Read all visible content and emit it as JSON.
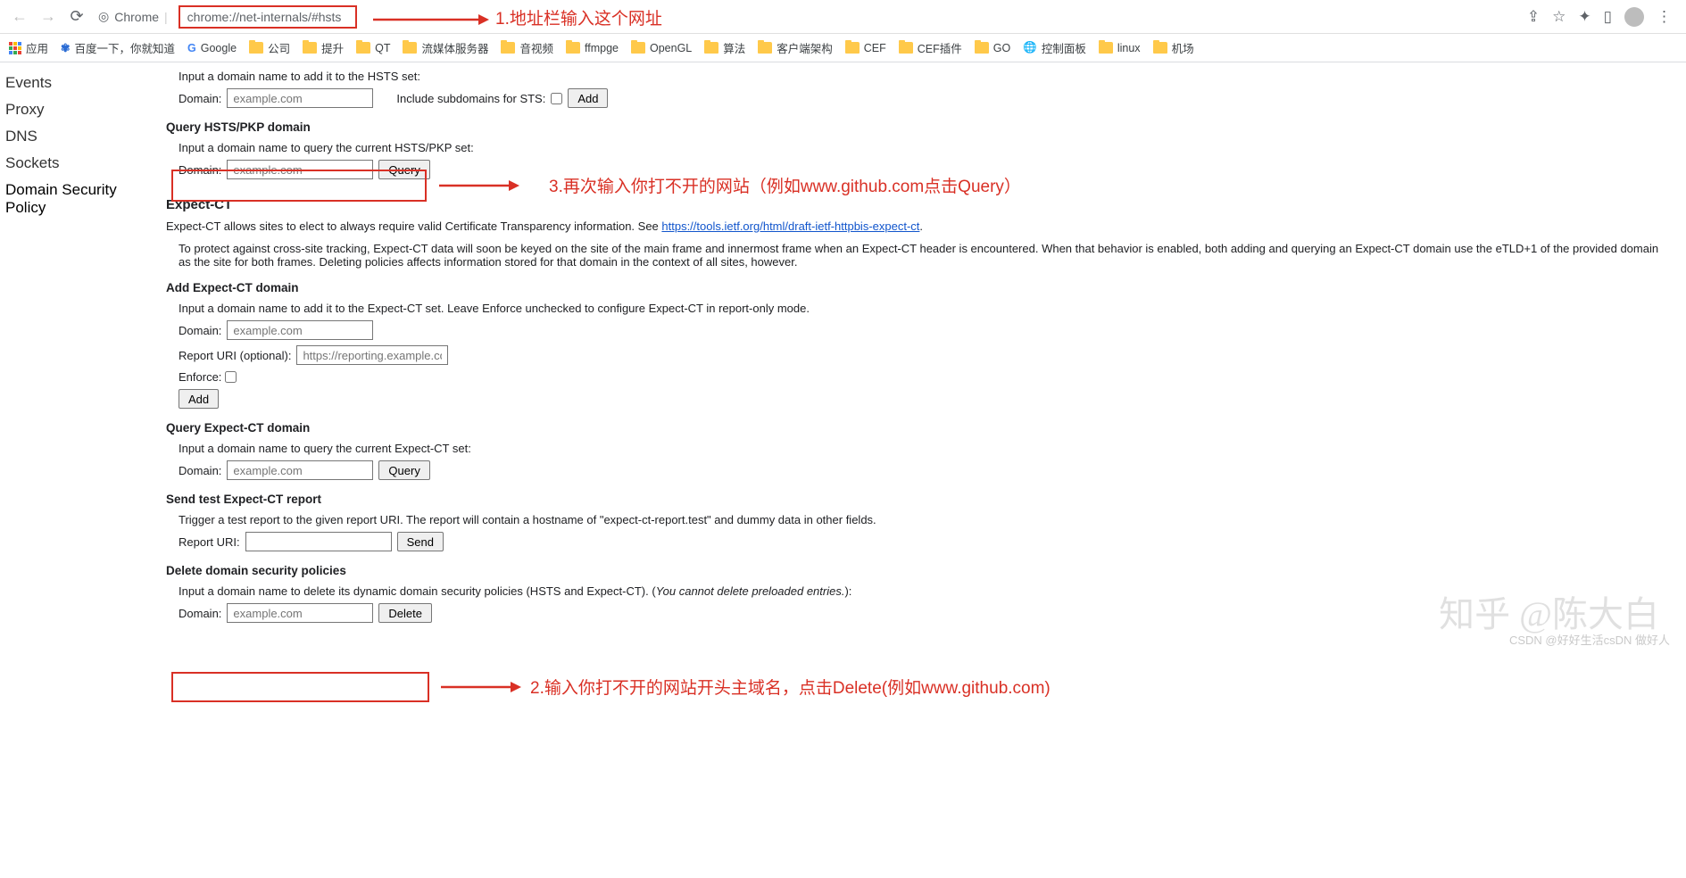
{
  "browser": {
    "chrome_label": "Chrome",
    "url": "chrome://net-internals/#hsts"
  },
  "bookmarks": {
    "apps": "应用",
    "items": [
      "百度一下，你就知道",
      "Google",
      "公司",
      "提升",
      "QT",
      "流媒体服务器",
      "音视频",
      "ffmpge",
      "OpenGL",
      "算法",
      "客户端架构",
      "CEF",
      "CEF插件",
      "GO",
      "控制面板",
      "linux",
      "机场"
    ]
  },
  "sidebar": [
    "Events",
    "Proxy",
    "DNS",
    "Sockets",
    "Domain Security Policy"
  ],
  "content": {
    "add_hsts_instr": "Input a domain name to add it to the HSTS set:",
    "domain_label": "Domain:",
    "placeholder": "example.com",
    "include_sub": "Include subdomains for STS:",
    "add_btn": "Add",
    "query_hsts_hd": "Query HSTS/PKP domain",
    "query_hsts_instr": "Input a domain name to query the current HSTS/PKP set:",
    "query_btn": "Query",
    "expect_ct_hd": "Expect-CT",
    "expect_ct_desc_a": "Expect-CT allows sites to elect to always require valid Certificate Transparency information. See ",
    "expect_ct_link": "https://tools.ietf.org/html/draft-ietf-httpbis-expect-ct",
    "expect_ct_note": "To protect against cross-site tracking, Expect-CT data will soon be keyed on the site of the main frame and innermost frame when an Expect-CT header is encountered. When that behavior is enabled, both adding and querying an Expect-CT domain use the eTLD+1 of the provided domain as the site for both frames. Deleting policies affects information stored for that domain in the context of all sites, however.",
    "add_ect_hd": "Add Expect-CT domain",
    "add_ect_instr": "Input a domain name to add it to the Expect-CT set. Leave Enforce unchecked to configure Expect-CT in report-only mode.",
    "report_uri_label": "Report URI (optional):",
    "report_uri_ph": "https://reporting.example.co",
    "enforce_label": "Enforce:",
    "query_ect_hd": "Query Expect-CT domain",
    "query_ect_instr": "Input a domain name to query the current Expect-CT set:",
    "send_test_hd": "Send test Expect-CT report",
    "send_test_instr": "Trigger a test report to the given report URI. The report will contain a hostname of \"expect-ct-report.test\" and dummy data in other fields.",
    "report_uri2": "Report URI:",
    "send_btn": "Send",
    "delete_hd": "Delete domain security policies",
    "delete_instr_a": "Input a domain name to delete its dynamic domain security policies (HSTS and Expect-CT). (",
    "delete_instr_b": "You cannot delete preloaded entries.",
    "delete_instr_c": "):",
    "delete_btn": "Delete"
  },
  "annotations": {
    "a1": "1.地址栏输入这个网址",
    "a2": "2.输入你打不开的网站开头主域名，点击Delete(例如www.github.com)",
    "a3": "3.再次输入你打不开的网站（例如www.github.com点击Query）"
  },
  "watermark1": "知乎 @陈大白",
  "watermark2": "CSDN @好好生活csDN 做好人"
}
